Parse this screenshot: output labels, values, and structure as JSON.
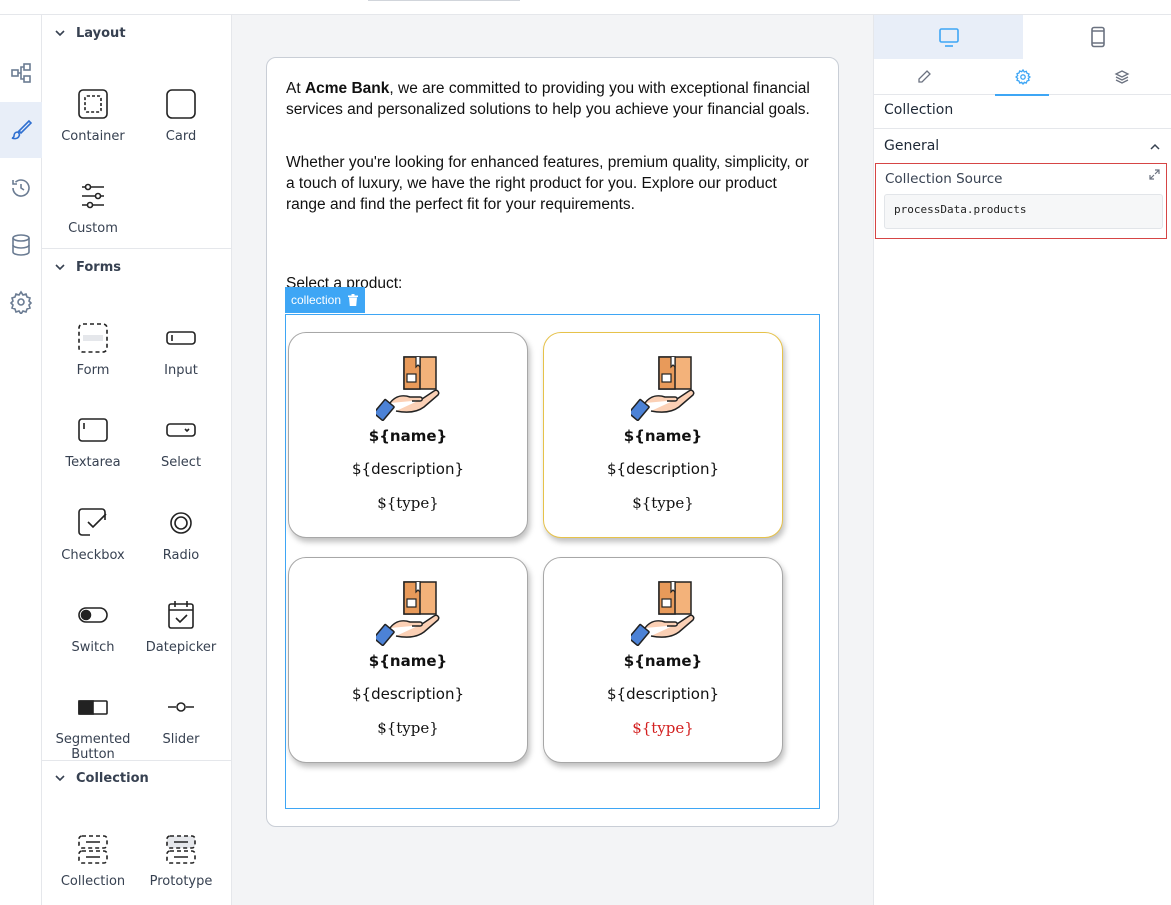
{
  "sidebar": {
    "rail_icons": [
      "process-flow-icon",
      "paintbrush-icon",
      "history-icon",
      "database-icon",
      "settings-icon"
    ],
    "sections": [
      {
        "title": "Layout",
        "items": [
          "Container",
          "Card",
          "Custom"
        ]
      },
      {
        "title": "Forms",
        "items": [
          "Form",
          "Input",
          "Textarea",
          "Select",
          "Checkbox",
          "Radio",
          "Switch",
          "Datepicker",
          "Segmented Button",
          "Slider"
        ]
      },
      {
        "title": "Collection",
        "items": [
          "Collection",
          "Prototype"
        ]
      }
    ]
  },
  "canvas": {
    "para1_prefix": "At ",
    "para1_bold": "Acme Bank",
    "para1_rest": ", we are committed to providing you with exceptional financial services and personalized solutions to help you achieve your financial goals.",
    "para2": "Whether you're looking for enhanced features, premium quality, simplicity, or a touch of luxury, we have the right product for you. Explore our product range and find the perfect fit for your requirements.",
    "select_label": "Select a product:",
    "collection_tag": "collection",
    "cards": [
      {
        "name": "${name}",
        "description": "${description}",
        "type": "${type}",
        "selected": false,
        "type_color": "#111111"
      },
      {
        "name": "${name}",
        "description": "${description}",
        "type": "${type}",
        "selected": true,
        "type_color": "#111111"
      },
      {
        "name": "${name}",
        "description": "${description}",
        "type": "${type}",
        "selected": false,
        "type_color": "#111111"
      },
      {
        "name": "${name}",
        "description": "${description}",
        "type": "${type}",
        "selected": false,
        "type_color": "#d32020"
      }
    ]
  },
  "properties": {
    "device_tabs": [
      "desktop-icon",
      "mobile-icon"
    ],
    "mode_tabs": [
      "pencil-icon",
      "gear-icon",
      "layers-icon"
    ],
    "title": "Collection",
    "general_label": "General",
    "source_label": "Collection Source",
    "source_value": "processData.products"
  },
  "colors": {
    "accent": "#3ea6f5",
    "selected_card_border": "#e6c24a",
    "highlight_box": "#d64545"
  }
}
